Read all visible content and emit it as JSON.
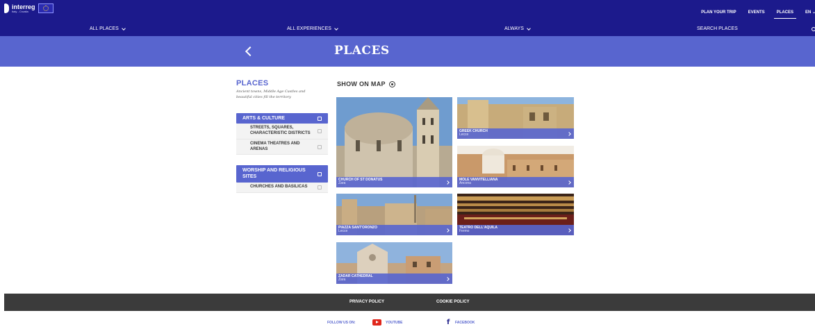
{
  "brand": {
    "name": "interreg",
    "subtitle": "Italy - Croatia"
  },
  "nav": {
    "items": [
      "PLAN YOUR TRIP",
      "EVENTS",
      "PLACES"
    ],
    "active": "PLACES",
    "lang": "EN"
  },
  "filters": {
    "places": "ALL PLACES",
    "experiences": "ALL EXPERIENCES",
    "time": "ALWAYS",
    "search": "SEARCH PLACES"
  },
  "page": {
    "title": "PLACES"
  },
  "sidebar": {
    "title": "PLACES",
    "description": "Ancient towns, Middle Age Castles and beautiful cities fill the territory",
    "categories": [
      {
        "label": "ARTS & CULTURE",
        "items": [
          "STREETS, SQUARES, CHARACTERISTIC DISTRICTS",
          "CINEMA THEATRES AND ARENAS"
        ]
      },
      {
        "label": "WORSHIP AND RELIGIOUS SITES",
        "items": [
          "CHURCHES AND BASILICAS"
        ]
      }
    ]
  },
  "map": {
    "label": "SHOW ON MAP"
  },
  "places": [
    {
      "name": "CHURCH OF ST DONATUS",
      "location": "Zara"
    },
    {
      "name": "GREEK CHURCH",
      "location": "Lecce"
    },
    {
      "name": "MOLE VANVITELLIANA",
      "location": "Ancona"
    },
    {
      "name": "PIAZZA SANT'ORONZO",
      "location": "Lecce"
    },
    {
      "name": "TEATRO DELL'AQUILA",
      "location": "Fermo"
    },
    {
      "name": "ZADAR CATHEDRAL",
      "location": "Zara"
    }
  ],
  "footer": {
    "privacy": "PRIVACY POLICY",
    "cookie": "COOKIE POLICY",
    "follow": "FOLLOW US ON:",
    "youtube": "YOUTUBE",
    "facebook": "FACEBOOK"
  },
  "colors": {
    "navy": "#1c1a8c",
    "accent": "#5865cf",
    "footer": "#3b3b3b"
  }
}
